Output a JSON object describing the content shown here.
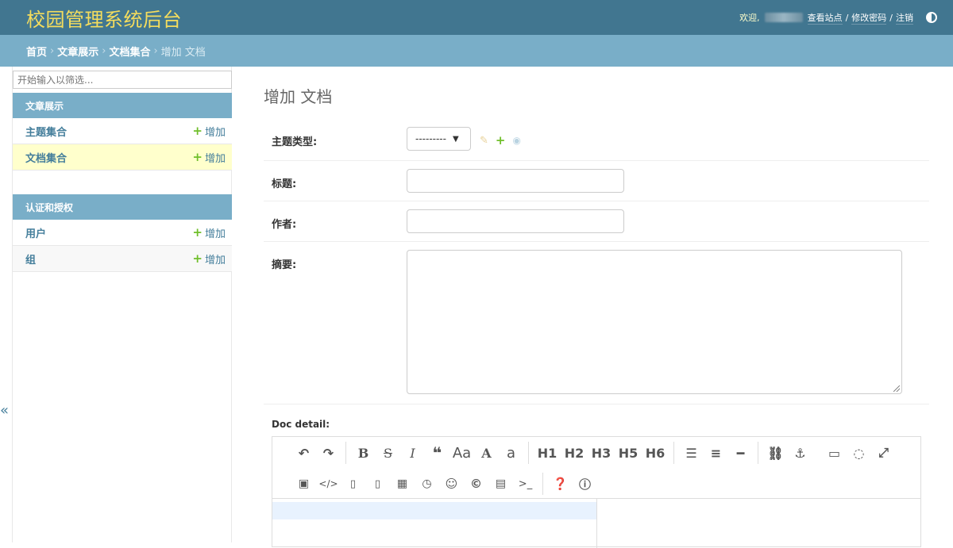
{
  "header": {
    "site_title": "校园管理系统后台",
    "welcome": "欢迎,",
    "view_site": "查看站点",
    "change_password": "修改密码",
    "logout": "注销",
    "separator": "/"
  },
  "breadcrumbs": {
    "home": "首页",
    "app": "文章展示",
    "model": "文档集合",
    "current": "增加 文档",
    "arrow": "›"
  },
  "sidebar": {
    "filter_placeholder": "开始输入以筛选...",
    "modules": [
      {
        "caption": "文章展示",
        "models": [
          {
            "name": "主题集合",
            "add": "增加"
          },
          {
            "name": "文档集合",
            "add": "增加"
          }
        ]
      },
      {
        "caption": "认证和授权",
        "models": [
          {
            "name": "用户",
            "add": "增加"
          },
          {
            "name": "组",
            "add": "增加"
          }
        ]
      }
    ],
    "collapse": "«"
  },
  "content": {
    "title": "增加 文档",
    "fields": {
      "topic_type": {
        "label": "主题类型:",
        "selected": "---------"
      },
      "title": {
        "label": "标题:",
        "value": ""
      },
      "author": {
        "label": "作者:",
        "value": ""
      },
      "summary": {
        "label": "摘要:",
        "value": ""
      }
    },
    "doc_detail_label": "Doc detail:",
    "toolbar": {
      "h1": "H1",
      "h2": "H2",
      "h3": "H3",
      "h4": "H5",
      "h5": "H6",
      "uppercase": "Aa",
      "size_a": "A",
      "lower_a": "a",
      "bold": "B",
      "strike": "S",
      "italic": "I",
      "quote": "❝"
    }
  }
}
